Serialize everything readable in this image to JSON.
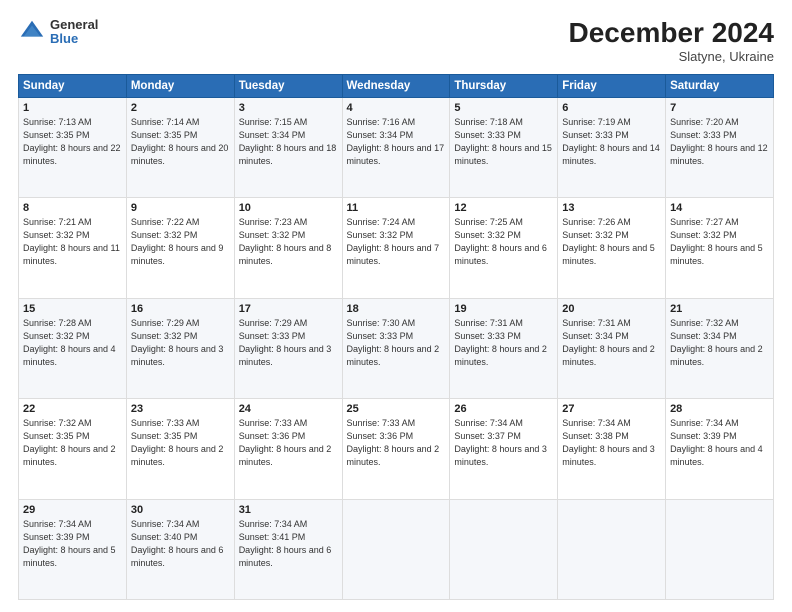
{
  "header": {
    "logo": {
      "general": "General",
      "blue": "Blue"
    },
    "title": "December 2024",
    "location": "Slatyne, Ukraine"
  },
  "days_of_week": [
    "Sunday",
    "Monday",
    "Tuesday",
    "Wednesday",
    "Thursday",
    "Friday",
    "Saturday"
  ],
  "weeks": [
    [
      {
        "day": "1",
        "sunrise": "7:13 AM",
        "sunset": "3:35 PM",
        "daylight": "8 hours and 22 minutes."
      },
      {
        "day": "2",
        "sunrise": "7:14 AM",
        "sunset": "3:35 PM",
        "daylight": "8 hours and 20 minutes."
      },
      {
        "day": "3",
        "sunrise": "7:15 AM",
        "sunset": "3:34 PM",
        "daylight": "8 hours and 18 minutes."
      },
      {
        "day": "4",
        "sunrise": "7:16 AM",
        "sunset": "3:34 PM",
        "daylight": "8 hours and 17 minutes."
      },
      {
        "day": "5",
        "sunrise": "7:18 AM",
        "sunset": "3:33 PM",
        "daylight": "8 hours and 15 minutes."
      },
      {
        "day": "6",
        "sunrise": "7:19 AM",
        "sunset": "3:33 PM",
        "daylight": "8 hours and 14 minutes."
      },
      {
        "day": "7",
        "sunrise": "7:20 AM",
        "sunset": "3:33 PM",
        "daylight": "8 hours and 12 minutes."
      }
    ],
    [
      {
        "day": "8",
        "sunrise": "7:21 AM",
        "sunset": "3:32 PM",
        "daylight": "8 hours and 11 minutes."
      },
      {
        "day": "9",
        "sunrise": "7:22 AM",
        "sunset": "3:32 PM",
        "daylight": "8 hours and 9 minutes."
      },
      {
        "day": "10",
        "sunrise": "7:23 AM",
        "sunset": "3:32 PM",
        "daylight": "8 hours and 8 minutes."
      },
      {
        "day": "11",
        "sunrise": "7:24 AM",
        "sunset": "3:32 PM",
        "daylight": "8 hours and 7 minutes."
      },
      {
        "day": "12",
        "sunrise": "7:25 AM",
        "sunset": "3:32 PM",
        "daylight": "8 hours and 6 minutes."
      },
      {
        "day": "13",
        "sunrise": "7:26 AM",
        "sunset": "3:32 PM",
        "daylight": "8 hours and 5 minutes."
      },
      {
        "day": "14",
        "sunrise": "7:27 AM",
        "sunset": "3:32 PM",
        "daylight": "8 hours and 5 minutes."
      }
    ],
    [
      {
        "day": "15",
        "sunrise": "7:28 AM",
        "sunset": "3:32 PM",
        "daylight": "8 hours and 4 minutes."
      },
      {
        "day": "16",
        "sunrise": "7:29 AM",
        "sunset": "3:32 PM",
        "daylight": "8 hours and 3 minutes."
      },
      {
        "day": "17",
        "sunrise": "7:29 AM",
        "sunset": "3:33 PM",
        "daylight": "8 hours and 3 minutes."
      },
      {
        "day": "18",
        "sunrise": "7:30 AM",
        "sunset": "3:33 PM",
        "daylight": "8 hours and 2 minutes."
      },
      {
        "day": "19",
        "sunrise": "7:31 AM",
        "sunset": "3:33 PM",
        "daylight": "8 hours and 2 minutes."
      },
      {
        "day": "20",
        "sunrise": "7:31 AM",
        "sunset": "3:34 PM",
        "daylight": "8 hours and 2 minutes."
      },
      {
        "day": "21",
        "sunrise": "7:32 AM",
        "sunset": "3:34 PM",
        "daylight": "8 hours and 2 minutes."
      }
    ],
    [
      {
        "day": "22",
        "sunrise": "7:32 AM",
        "sunset": "3:35 PM",
        "daylight": "8 hours and 2 minutes."
      },
      {
        "day": "23",
        "sunrise": "7:33 AM",
        "sunset": "3:35 PM",
        "daylight": "8 hours and 2 minutes."
      },
      {
        "day": "24",
        "sunrise": "7:33 AM",
        "sunset": "3:36 PM",
        "daylight": "8 hours and 2 minutes."
      },
      {
        "day": "25",
        "sunrise": "7:33 AM",
        "sunset": "3:36 PM",
        "daylight": "8 hours and 2 minutes."
      },
      {
        "day": "26",
        "sunrise": "7:34 AM",
        "sunset": "3:37 PM",
        "daylight": "8 hours and 3 minutes."
      },
      {
        "day": "27",
        "sunrise": "7:34 AM",
        "sunset": "3:38 PM",
        "daylight": "8 hours and 3 minutes."
      },
      {
        "day": "28",
        "sunrise": "7:34 AM",
        "sunset": "3:39 PM",
        "daylight": "8 hours and 4 minutes."
      }
    ],
    [
      {
        "day": "29",
        "sunrise": "7:34 AM",
        "sunset": "3:39 PM",
        "daylight": "8 hours and 5 minutes."
      },
      {
        "day": "30",
        "sunrise": "7:34 AM",
        "sunset": "3:40 PM",
        "daylight": "8 hours and 6 minutes."
      },
      {
        "day": "31",
        "sunrise": "7:34 AM",
        "sunset": "3:41 PM",
        "daylight": "8 hours and 6 minutes."
      },
      null,
      null,
      null,
      null
    ]
  ]
}
